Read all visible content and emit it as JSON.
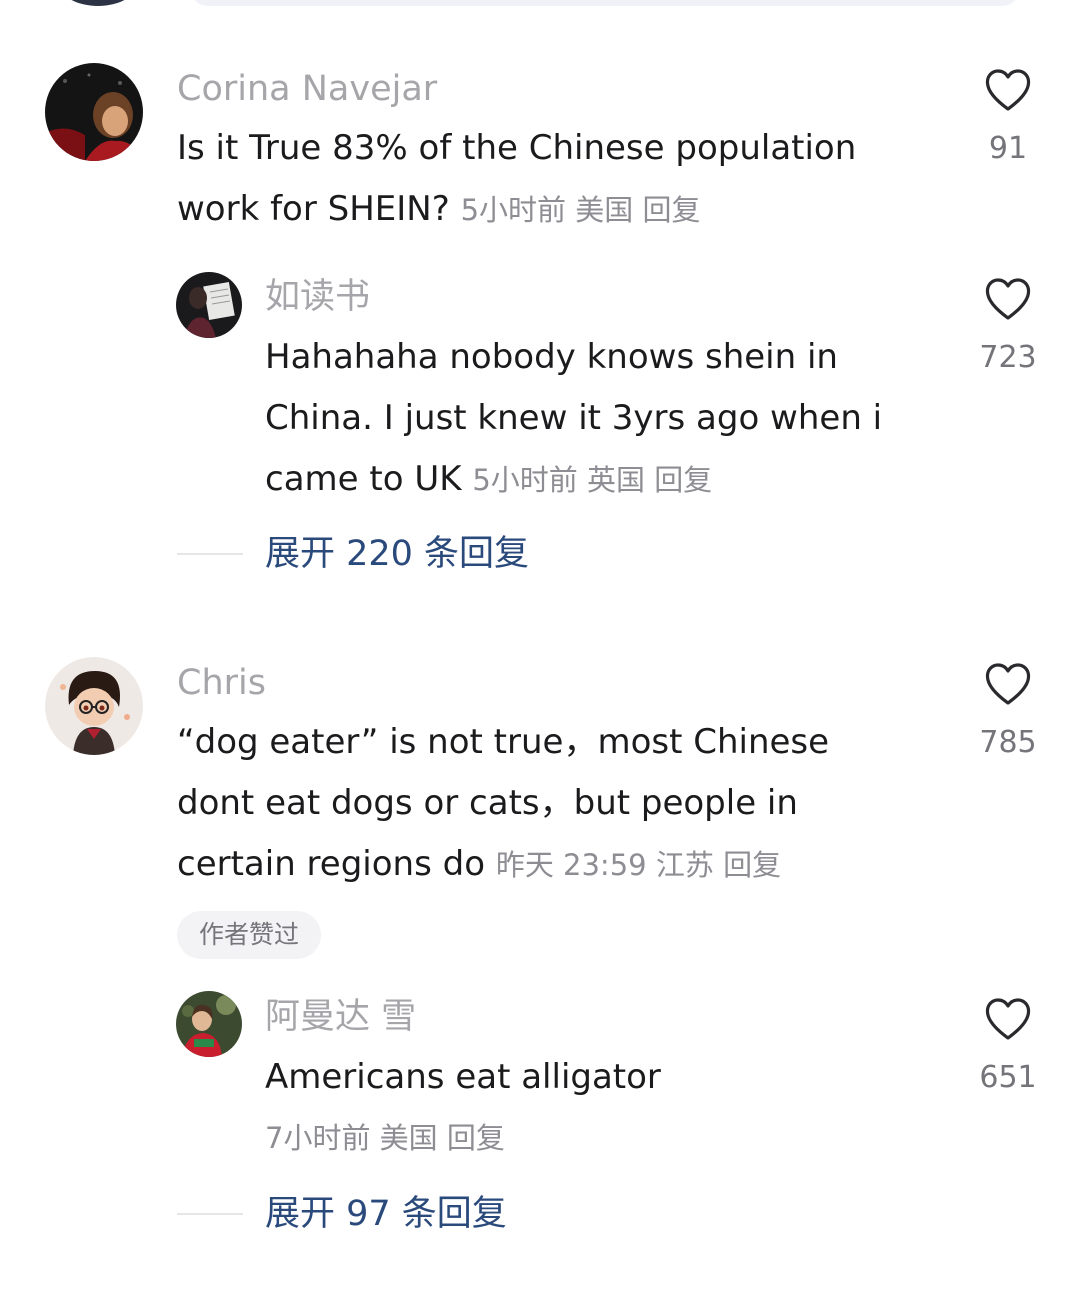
{
  "comments": [
    {
      "username": "Corina Navejar",
      "text_line1": "Is it True 83% of the Chinese population",
      "text_line2": "work for SHEIN?",
      "time": "5小时前",
      "location": "美国",
      "reply_label": "回复",
      "likes": "91",
      "replies": [
        {
          "username": "如读书",
          "text_line1": "Hahahaha nobody knows shein in",
          "text_line2": "China. I just knew it 3yrs ago when i",
          "text_line3": "came to UK",
          "time": "5小时前",
          "location": "英国",
          "reply_label": "回复",
          "likes": "723"
        }
      ],
      "expand_label": "展开 220 条回复"
    },
    {
      "username": "Chris",
      "text_line1": "“dog eater” is not true，most Chinese",
      "text_line2": "dont eat dogs or cats，but people in",
      "text_line3": "certain regions do",
      "time": "昨天 23:59",
      "location": "江苏",
      "reply_label": "回复",
      "likes": "785",
      "badge": "作者赞过",
      "replies": [
        {
          "username": "阿曼达 雪",
          "text_line1": "Americans eat alligator",
          "time": "7小时前",
          "location": "美国",
          "reply_label": "回复",
          "likes": "651"
        }
      ],
      "expand_label": "展开 97 条回复"
    }
  ],
  "colors": {
    "username": "#a6a6aa",
    "text": "#1b1b1d",
    "meta": "#8d8d93",
    "expand": "#2b4a7c",
    "heart_stroke": "#2a2a2e"
  },
  "icons": {
    "like": "heart-outline-icon"
  }
}
